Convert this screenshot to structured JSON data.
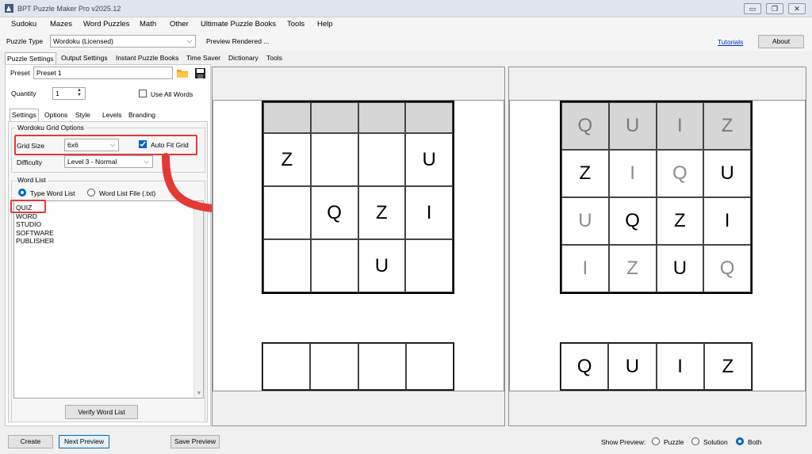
{
  "window": {
    "title": "BPT Puzzle Maker Pro v2025.12",
    "minimize": "▭",
    "restore": "❐",
    "close": "✕"
  },
  "menu": [
    "Sudoku",
    "Mazes",
    "Word Puzzles",
    "Math",
    "Other",
    "Ultimate Puzzle Books",
    "Tools",
    "Help"
  ],
  "toolbar": {
    "puzzle_type_label": "Puzzle Type",
    "puzzle_type_value": "Wordoku (Licensed)",
    "status": "Preview Rendered ...",
    "tutorials_link": "Tutorials",
    "about_button": "About"
  },
  "main_tabs": [
    "Puzzle Settings",
    "Output Settings",
    "Instant Puzzle Books",
    "Time Saver",
    "Dictionary",
    "Tools"
  ],
  "preset": {
    "label": "Preset",
    "value": "Preset 1"
  },
  "quantity": {
    "label": "Quantity",
    "value": "1",
    "use_all_words": "Use All Words"
  },
  "sub_tabs": [
    "Settings",
    "Options",
    "Style",
    "Levels",
    "Branding"
  ],
  "grid_options": {
    "title": "Wordoku Grid Options",
    "grid_size_label": "Grid Size",
    "grid_size_value": "6x6",
    "auto_fit_label": "Auto Fit Grid",
    "difficulty_label": "Difficulty",
    "difficulty_value": "Level 3 - Normal"
  },
  "word_list": {
    "title": "Word List",
    "type_word_list": "Type Word List",
    "word_list_file": "Word List File (.txt)",
    "words": [
      "QUIZ",
      "WORD",
      "STUDIO",
      "SOFTWARE",
      "PUBLISHER"
    ],
    "verify_button": "Verify Word List"
  },
  "puzzle_preview": {
    "rows": [
      [
        "",
        "",
        "",
        ""
      ],
      [
        "Z",
        "",
        "",
        "U"
      ],
      [
        "",
        "Q",
        "Z",
        "I"
      ],
      [
        "",
        "",
        "U",
        ""
      ]
    ],
    "answer_row": [
      "",
      "",
      "",
      ""
    ]
  },
  "solution_preview": {
    "rows": [
      [
        "Q",
        "U",
        "I",
        "Z"
      ],
      [
        "Z",
        "I",
        "Q",
        "U"
      ],
      [
        "U",
        "Q",
        "Z",
        "I"
      ],
      [
        "I",
        "Z",
        "U",
        "Q"
      ]
    ],
    "given": [
      [
        false,
        false,
        false,
        false
      ],
      [
        true,
        false,
        false,
        true
      ],
      [
        false,
        true,
        true,
        true
      ],
      [
        false,
        false,
        true,
        false
      ]
    ],
    "answer_row": [
      "Q",
      "U",
      "I",
      "Z"
    ]
  },
  "bottom": {
    "create_button": "Create",
    "next_preview_button": "Next Preview",
    "save_preview_button": "Save Preview",
    "show_preview_label": "Show Preview:",
    "opt_puzzle": "Puzzle",
    "opt_solution": "Solution",
    "opt_both": "Both"
  },
  "colors": {
    "accent": "#0067c0",
    "highlight": "#e53935",
    "header_cell": "#d6d6d6"
  }
}
